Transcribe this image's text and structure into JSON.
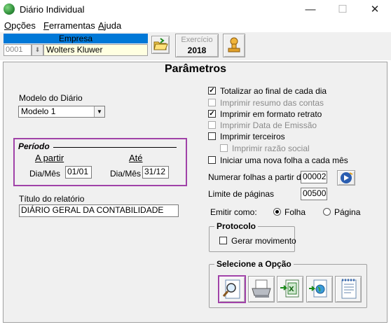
{
  "window": {
    "title": "Diário Individual",
    "minimize": "—",
    "maximize": "☐",
    "close": "✕"
  },
  "menu": [
    {
      "label": "Opções",
      "u": "O",
      "rest": "pções"
    },
    {
      "label": "Ferramentas",
      "u": "F",
      "rest": "erramentas"
    },
    {
      "label": "Ajuda",
      "u": "A",
      "rest": "juda"
    }
  ],
  "toolbar": {
    "empresa_label": "Empresa",
    "empresa_code": "0001",
    "empresa_name": "Wolters Kluwer",
    "exercicio_label": "Exercício",
    "exercicio_value": "2018"
  },
  "panel": {
    "title": "Parâmetros",
    "modelo_label": "Modelo do Diário",
    "modelo_value": "Modelo 1",
    "periodo": {
      "title": "Período",
      "from_label": "A partir",
      "to_label": "Até",
      "dia_mes_label": "Dia/Mês",
      "from_value": "01/01",
      "to_value": "31/12"
    },
    "titulo_label": "Título do relatório",
    "titulo_value": "DIÁRIO GERAL DA CONTABILIDADE",
    "options": [
      {
        "label": "Totalizar ao final de cada dia",
        "checked": true,
        "enabled": true
      },
      {
        "label": "Imprimir resumo das contas",
        "checked": false,
        "enabled": false
      },
      {
        "label": "Imprimir em formato retrato",
        "checked": true,
        "enabled": true
      },
      {
        "label": "Imprimir Data de Emissão",
        "checked": false,
        "enabled": false
      },
      {
        "label": "Imprimir terceiros",
        "checked": false,
        "enabled": true
      },
      {
        "label": "Imprimir razão social",
        "checked": false,
        "enabled": false
      },
      {
        "label": "Iniciar uma nova folha a cada mês",
        "checked": false,
        "enabled": true
      }
    ],
    "numerar_label": "Numerar folhas a partir de:",
    "numerar_value": "00002",
    "limite_label": "Limite de páginas",
    "limite_value": "00500",
    "emitir_label": "Emitir como:",
    "emitir_options": [
      "Folha",
      "Página"
    ],
    "emitir_selected": "Folha",
    "protocolo": {
      "title": "Protocolo",
      "gerar_label": "Gerar movimento",
      "gerar_checked": false
    },
    "selecione": {
      "title": "Selecione a Opção"
    }
  }
}
